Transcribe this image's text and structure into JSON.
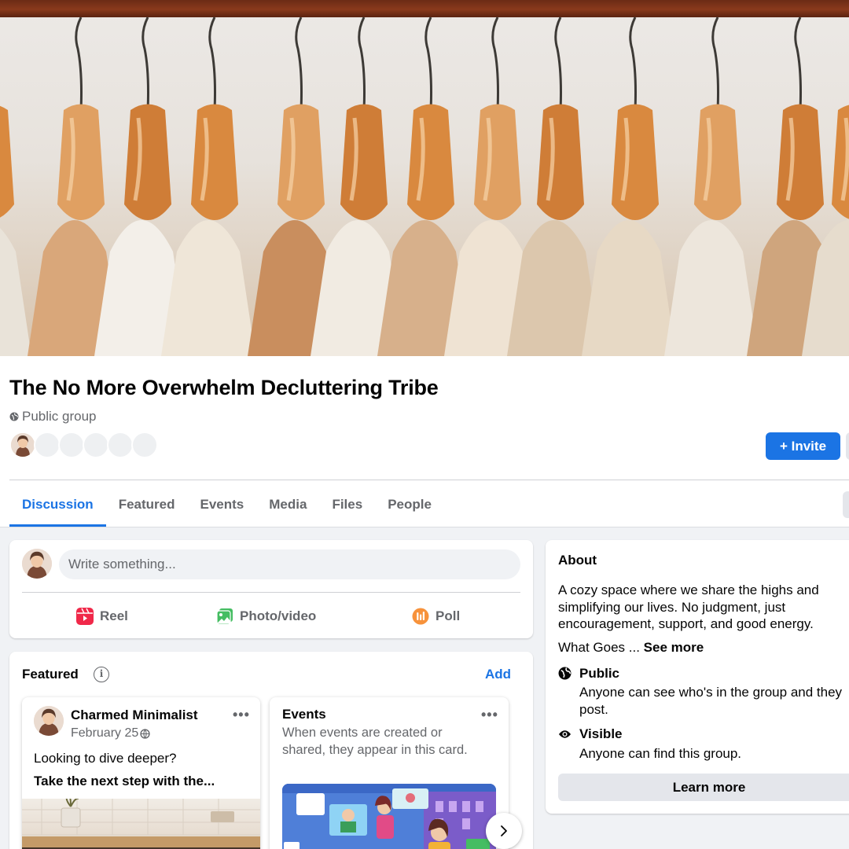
{
  "cover": {
    "alt": "Wooden hangers with sweaters on a clothing rail"
  },
  "group": {
    "name": "The No More Overwhelm Decluttering Tribe",
    "privacy": "Public group",
    "invite_label": "+ Invite"
  },
  "tabs": [
    {
      "label": "Discussion",
      "active": true
    },
    {
      "label": "Featured"
    },
    {
      "label": "Events"
    },
    {
      "label": "Media"
    },
    {
      "label": "Files"
    },
    {
      "label": "People"
    }
  ],
  "composer": {
    "placeholder": "Write something...",
    "actions": [
      {
        "label": "Reel",
        "icon": "reel-icon",
        "color": "#f02849"
      },
      {
        "label": "Photo/video",
        "icon": "photo-video-icon",
        "color": "#45bd62"
      },
      {
        "label": "Poll",
        "icon": "poll-icon",
        "color": "#f7923b"
      }
    ]
  },
  "featured": {
    "title": "Featured",
    "add_label": "Add",
    "post": {
      "author": "Charmed Minimalist",
      "date": "February 25",
      "line1": "Looking to dive deeper?",
      "line2": "Take the next step with the..."
    },
    "events_card": {
      "title": "Events",
      "description": "When events are created or shared, they appear in this card."
    }
  },
  "about": {
    "title": "About",
    "description": "A cozy space where we share the highs and\nsimplifying our lives. No judgment, just\nencouragement, support, and good energy.",
    "what_goes": "What Goes ...",
    "see_more": "See more",
    "public_title": "Public",
    "public_sub": "Anyone can see who's in the group and they post.",
    "visible_title": "Visible",
    "visible_sub": "Anyone can find this group.",
    "learn_more": "Learn more"
  },
  "colors": {
    "accent": "#1b74e4",
    "bg": "#f0f2f5",
    "muted_text": "#65676b"
  }
}
